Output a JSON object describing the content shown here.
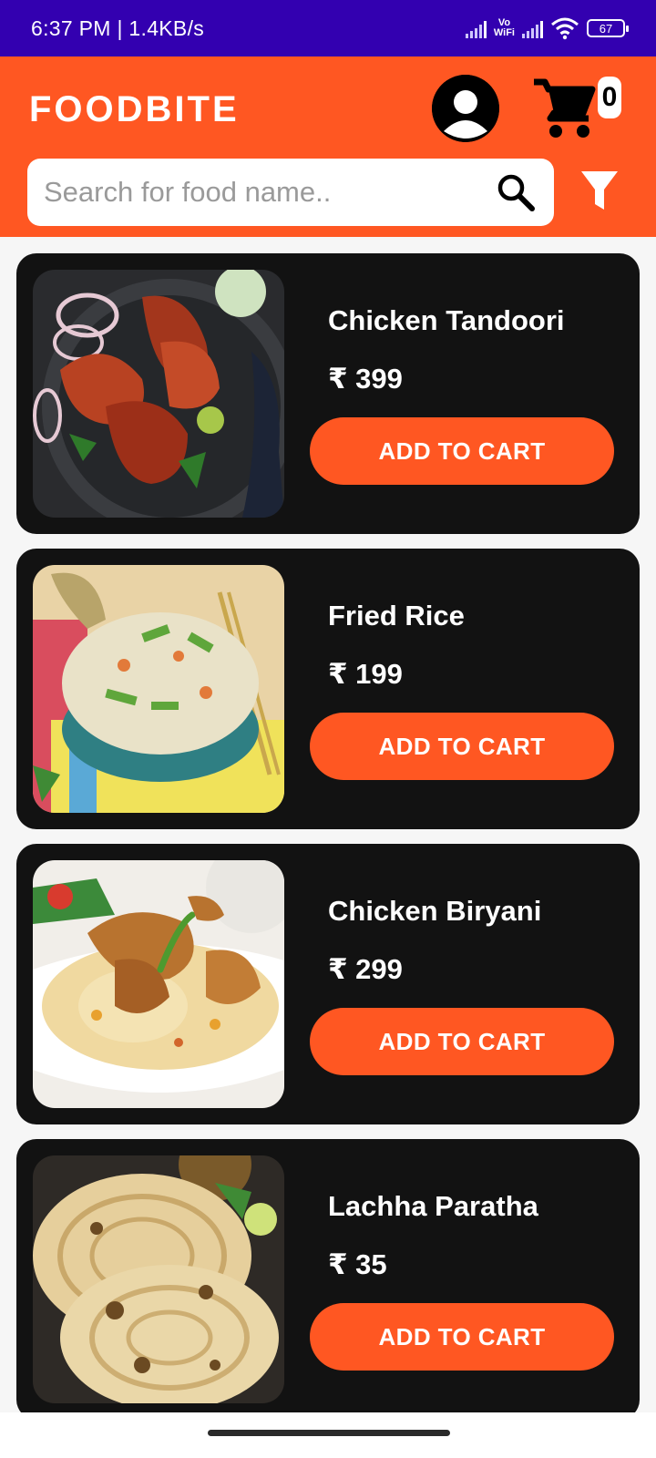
{
  "status_bar": {
    "time_net": "6:37 PM | 1.4KB/s",
    "vowifi_top": "Vo",
    "vowifi_bottom": "WiFi",
    "battery": "67"
  },
  "header": {
    "brand": "FOODBITE",
    "cart_count": "0"
  },
  "search": {
    "placeholder": "Search for food name.."
  },
  "colors": {
    "accent": "#ff5722",
    "status_bar": "#3300b0",
    "card": "#121212"
  },
  "foods": [
    {
      "name": "Chicken Tandoori",
      "price": "₹ 399",
      "button": "ADD TO CART"
    },
    {
      "name": "Fried Rice",
      "price": "₹ 199",
      "button": "ADD TO CART"
    },
    {
      "name": "Chicken Biryani",
      "price": "₹ 299",
      "button": "ADD TO CART"
    },
    {
      "name": "Lachha Paratha",
      "price": "₹ 35",
      "button": "ADD TO CART"
    }
  ],
  "icons": {
    "profile": "user-avatar-icon",
    "cart": "shopping-cart-icon",
    "search": "search-icon",
    "filter": "filter-funnel-icon"
  }
}
